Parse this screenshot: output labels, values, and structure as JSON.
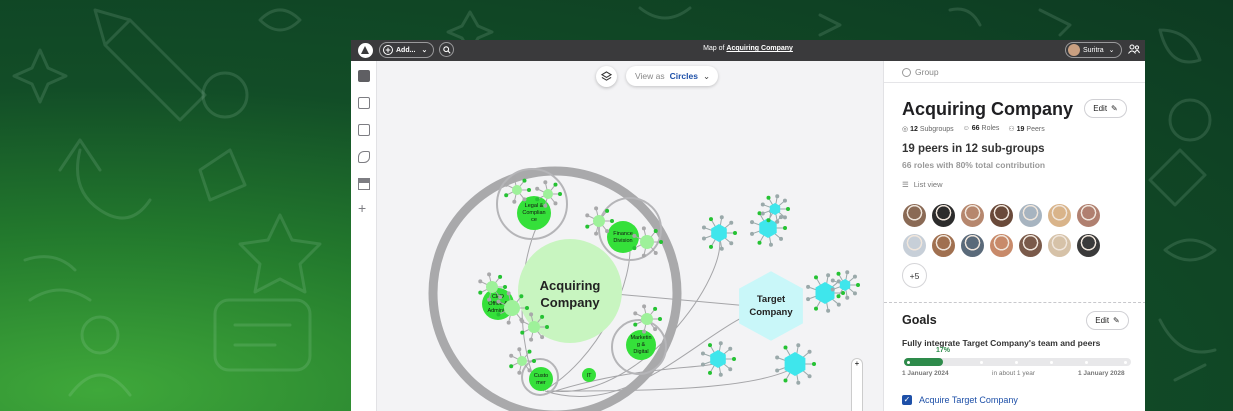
{
  "window": {
    "add_label": "Add...",
    "title_prefix": "Map of",
    "title_name": "Acquiring Company",
    "user_name": "Suritra"
  },
  "toolbar": {
    "view_as_label": "View as",
    "view_as_value": "Circles",
    "zoom_in": "+"
  },
  "map": {
    "main_node": [
      "Acquiring",
      "Company"
    ],
    "target_node": [
      "Target",
      "Company"
    ],
    "subgroups": [
      {
        "lines": [
          "Legal &",
          "Complian",
          "ce"
        ]
      },
      {
        "lines": [
          "Finance",
          "Division"
        ]
      },
      {
        "lines": [
          "CEO",
          "Office &",
          "Administ"
        ]
      },
      {
        "lines": [
          "Marketin",
          "g &",
          "Digital"
        ]
      },
      {
        "lines": [
          "Custo",
          "mer"
        ]
      },
      {
        "lines": [
          "IT"
        ]
      }
    ],
    "colors": {
      "acquiring": "#35e03a",
      "acquiring_light": "#c8f5c0",
      "target": "#3fe6ec",
      "target_light": "#c9f7f9",
      "ring": "#a9a9ab"
    }
  },
  "panel": {
    "type_label": "Group",
    "title": "Acquiring Company",
    "edit_label": "Edit",
    "stats": {
      "subgroups_count": "12",
      "subgroups_label": "Subgroups",
      "roles_count": "66",
      "roles_label": "Roles",
      "peers_count": "19",
      "peers_label": "Peers"
    },
    "peers_heading": "19 peers in 12 sub-groups",
    "roles_line": "66 roles with 80% total contribution",
    "list_view": "List view",
    "more_count": "+5",
    "goals_heading": "Goals",
    "goals_edit_label": "Edit",
    "goal_text": "Fully integrate Target Company's team and peers",
    "goal_progress_label": "17%",
    "goal_progress": 0.17,
    "date_start": "1 January 2024",
    "date_mid": "in about 1 year",
    "date_end": "1 January 2028",
    "task_label": "Acquire Target Company"
  }
}
